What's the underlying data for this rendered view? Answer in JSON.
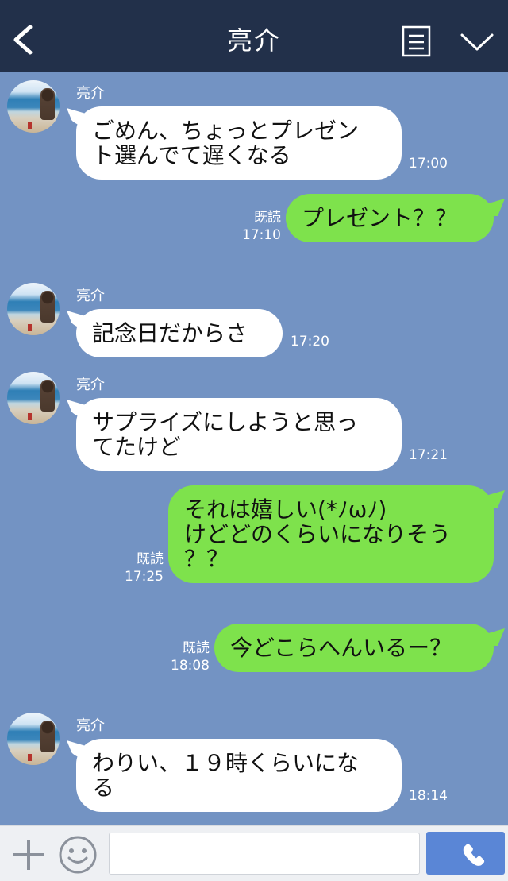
{
  "header": {
    "title": "亮介"
  },
  "messages": [
    {
      "dir": "in",
      "sender": "亮介",
      "lines": [
        "ごめん、ちょっとプレゼン",
        "ト選んでて遅くなる"
      ],
      "time": "17:00"
    },
    {
      "dir": "out",
      "lines": [
        "プレゼント？？"
      ],
      "read": "既読",
      "time": "17:10"
    },
    {
      "dir": "in",
      "sender": "亮介",
      "lines": [
        "記念日だからさ"
      ],
      "time": "17:20"
    },
    {
      "dir": "in",
      "sender": "亮介",
      "lines": [
        "サプライズにしようと思っ",
        "てたけど"
      ],
      "time": "17:21"
    },
    {
      "dir": "out",
      "lines": [
        "それは嬉しい(*ﾉωﾉ)",
        "けどどのくらいになりそう",
        "？？"
      ],
      "read": "既読",
      "time": "17:25"
    },
    {
      "dir": "out",
      "lines": [
        "今どこらへんいるー？"
      ],
      "read": "既読",
      "time": "18:08"
    },
    {
      "dir": "in",
      "sender": "亮介",
      "lines": [
        "わりい、１９時くらいにな",
        "る"
      ],
      "time": "18:14"
    }
  ],
  "input": {
    "value": "",
    "placeholder": ""
  },
  "icons": {
    "back": "chevron-left-icon",
    "menu": "document-icon",
    "dropdown": "chevron-down-icon",
    "add": "plus-icon",
    "emoji": "smiley-icon",
    "call": "phone-icon"
  },
  "colors": {
    "header_bg": "#22304a",
    "chat_bg": "#7393c3",
    "incoming_bubble": "#ffffff",
    "outgoing_bubble": "#7ee24c",
    "call_button": "#5a86d6"
  }
}
